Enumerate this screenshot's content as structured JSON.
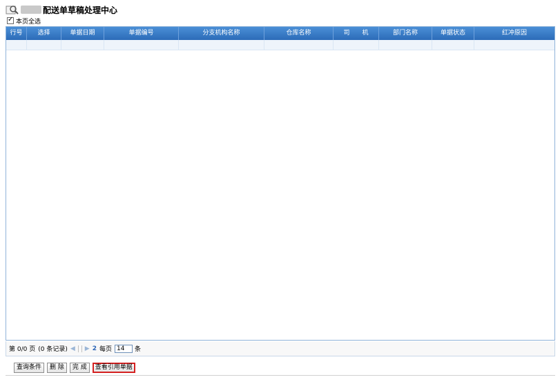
{
  "page": {
    "title": "配送单草稿处理中心",
    "select_all_label": "本页全选"
  },
  "grid": {
    "columns": [
      "行号",
      "选择",
      "单据日期",
      "单据编号",
      "分支机构名称",
      "仓库名称",
      "司　　机",
      "部门名称",
      "单据状态",
      "红冲原因"
    ]
  },
  "pager": {
    "page_info": "第 0/0 页",
    "record_info": "(0 条记录)",
    "first": "◀",
    "prev": "◁",
    "next": "▷",
    "last": "▶",
    "refresh": "2",
    "per_page_label": "每页",
    "page_size": "14",
    "unit": "条"
  },
  "buttons": {
    "query": "查询条件",
    "delete": "删 除",
    "complete": "完 成",
    "view_ref": "查看引用单据"
  },
  "colors": {
    "header_bg": "#2c6bb8",
    "highlight_border": "#d42020"
  }
}
